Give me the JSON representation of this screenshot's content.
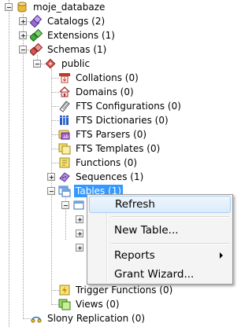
{
  "tree": {
    "database": "moje_databaze",
    "catalogs": "Catalogs (2)",
    "extensions": "Extensions (1)",
    "schemas": "Schemas (1)",
    "public": "public",
    "collations": "Collations (0)",
    "domains": "Domains (0)",
    "fts_configurations": "FTS Configurations (0)",
    "fts_dictionaries": "FTS Dictionaries (0)",
    "fts_parsers": "FTS Parsers (0)",
    "fts_templates": "FTS Templates (0)",
    "functions": "Functions (0)",
    "sequences": "Sequences (1)",
    "tables": "Tables (1)",
    "trigger_functions": "Trigger Functions (0)",
    "views": "Views (0)",
    "slony": "Slony Replication (0)"
  },
  "context_menu": {
    "refresh": "Refresh",
    "new_table": "New Table...",
    "reports": "Reports",
    "grant_wizard": "Grant Wizard..."
  },
  "colors": {
    "selection": "#3399ff",
    "menu_background": "#f4f4f4",
    "menu_hover": "#dcebfa"
  }
}
